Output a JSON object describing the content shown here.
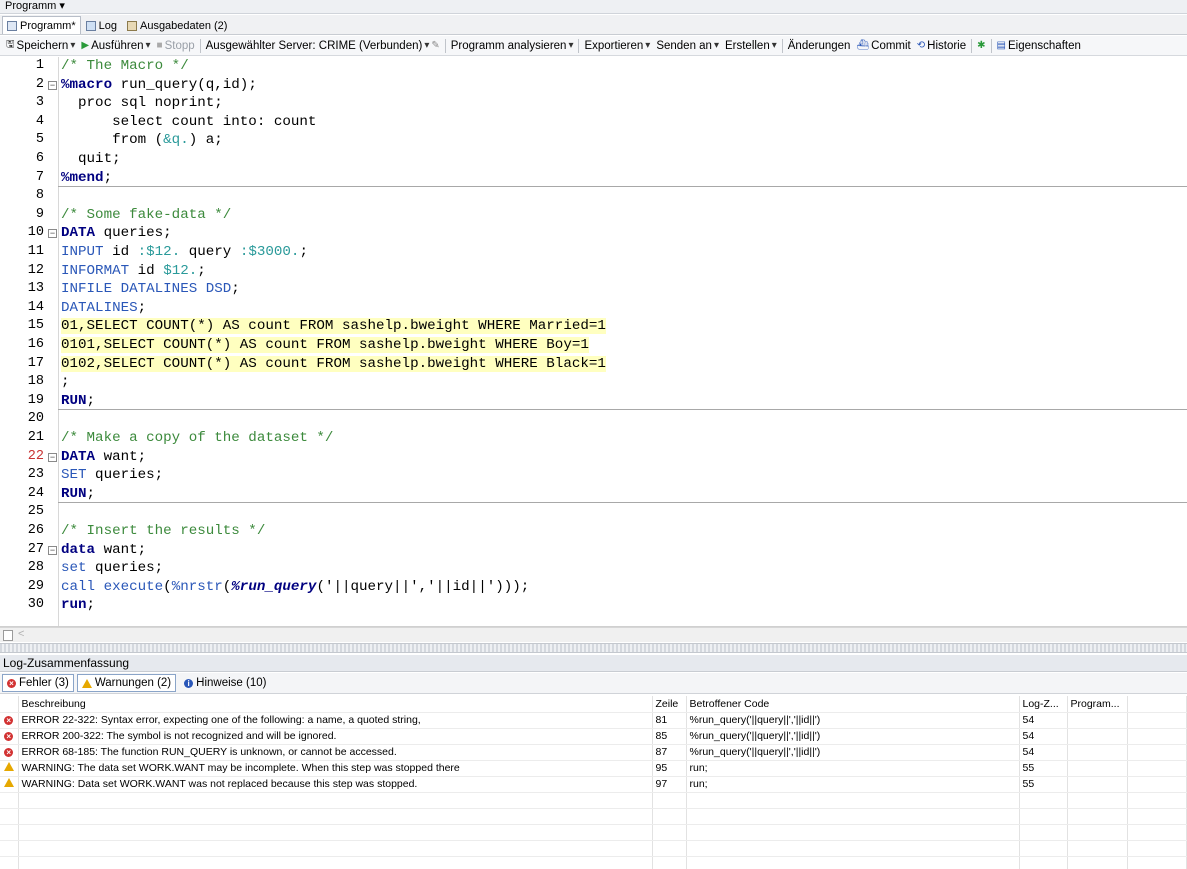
{
  "menu": {
    "title": "Programm ▾"
  },
  "tabs": [
    {
      "label": "Programm*"
    },
    {
      "label": "Log"
    },
    {
      "label": "Ausgabedaten (2)"
    }
  ],
  "toolbar": {
    "save": "Speichern",
    "run": "Ausführen",
    "stop": "Stopp",
    "server": "Ausgewählter Server: CRIME (Verbunden)",
    "analyze": "Programm analysieren",
    "export": "Exportieren",
    "send": "Senden an",
    "create": "Erstellen",
    "changes": "Änderungen",
    "commit": "Commit",
    "history": "Historie",
    "properties": "Eigenschaften"
  },
  "editor": {
    "current_line": "22",
    "lines": [
      {
        "n": "1",
        "text": "/* The Macro */"
      },
      {
        "n": "2",
        "text": "%macro run_query(q,id);"
      },
      {
        "n": "3",
        "text": "  proc sql noprint;"
      },
      {
        "n": "4",
        "text": "      select count into: count"
      },
      {
        "n": "5",
        "text": "      from (&q.) a;"
      },
      {
        "n": "6",
        "text": "  quit;"
      },
      {
        "n": "7",
        "text": "%mend;"
      },
      {
        "n": "8",
        "text": ""
      },
      {
        "n": "9",
        "text": "/* Some fake-data */"
      },
      {
        "n": "10",
        "text": "DATA queries;"
      },
      {
        "n": "11",
        "text": "INPUT id :$12. query :$3000.;"
      },
      {
        "n": "12",
        "text": "INFORMAT id $12.;"
      },
      {
        "n": "13",
        "text": "INFILE DATALINES DSD;"
      },
      {
        "n": "14",
        "text": "DATALINES;"
      },
      {
        "n": "15",
        "text": "01,SELECT COUNT(*) AS count FROM sashelp.bweight WHERE Married=1"
      },
      {
        "n": "16",
        "text": "0101,SELECT COUNT(*) AS count FROM sashelp.bweight WHERE Boy=1"
      },
      {
        "n": "17",
        "text": "0102,SELECT COUNT(*) AS count FROM sashelp.bweight WHERE Black=1"
      },
      {
        "n": "18",
        "text": ";"
      },
      {
        "n": "19",
        "text": "RUN;"
      },
      {
        "n": "20",
        "text": ""
      },
      {
        "n": "21",
        "text": "/* Make a copy of the dataset */"
      },
      {
        "n": "22",
        "text": "DATA want;"
      },
      {
        "n": "23",
        "text": "SET queries;"
      },
      {
        "n": "24",
        "text": "RUN;"
      },
      {
        "n": "25",
        "text": ""
      },
      {
        "n": "26",
        "text": "/* Insert the results */"
      },
      {
        "n": "27",
        "text": "data want;"
      },
      {
        "n": "28",
        "text": "set queries;"
      },
      {
        "n": "29",
        "text": "call execute(%nrstr(%run_query('||query||','||id||')));"
      },
      {
        "n": "30",
        "text": "run;"
      }
    ]
  },
  "log_summary": {
    "title": "Log-Zusammenfassung",
    "filters": {
      "errors": "Fehler (3)",
      "warnings": "Warnungen (2)",
      "notes": "Hinweise (10)"
    },
    "columns": [
      "Beschreibung",
      "Zeile",
      "Betroffener Code",
      "Log-Z...",
      "Program..."
    ],
    "rows": [
      {
        "type": "error",
        "desc": "ERROR 22-322: Syntax error, expecting one of the following: a name, a quoted string,",
        "line": "81",
        "code": "%run_query('||query||','||id||')",
        "logline": "54"
      },
      {
        "type": "error",
        "desc": "ERROR 200-322: The symbol is not recognized and will be ignored.",
        "line": "85",
        "code": "%run_query('||query||','||id||')",
        "logline": "54"
      },
      {
        "type": "error",
        "desc": "ERROR 68-185: The function RUN_QUERY is unknown, or cannot be accessed.",
        "line": "87",
        "code": "%run_query('||query||','||id||')",
        "logline": "54"
      },
      {
        "type": "warning",
        "desc": "WARNING: The data set WORK.WANT may be incomplete.  When this step was stopped there",
        "line": "95",
        "code": "run;",
        "logline": "55"
      },
      {
        "type": "warning",
        "desc": "WARNING: Data set WORK.WANT was not replaced because this step was stopped.",
        "line": "97",
        "code": "run;",
        "logline": "55"
      }
    ]
  },
  "colors": {
    "comment": "#3c8a3c",
    "keyword": "#000080",
    "builtin": "#2a57b8",
    "format": "#2a9a9a",
    "highlight": "#ffffc0",
    "error": "#d23232",
    "warning": "#e6a800"
  }
}
